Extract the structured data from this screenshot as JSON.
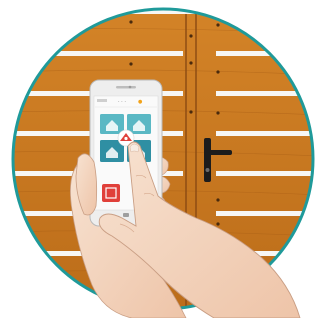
{
  "image": {
    "description_tag": "illustration",
    "colors": {
      "wood": "#c8781f",
      "wood_dark": "#8a4a12",
      "ring": "#1f9a9a",
      "slat": "#f7f7f5",
      "tile": "#5ab8c4",
      "tile_dark": "#2f8fa3",
      "alert_red": "#e0403a",
      "hand": "#f4d7c2"
    },
    "icons": [
      "gate-icon",
      "door-handle-icon",
      "smartphone-icon",
      "home-tile-icon",
      "alarm-tile-icon"
    ]
  },
  "phone": {
    "status_small": "· · ·",
    "title_dot": "●"
  }
}
